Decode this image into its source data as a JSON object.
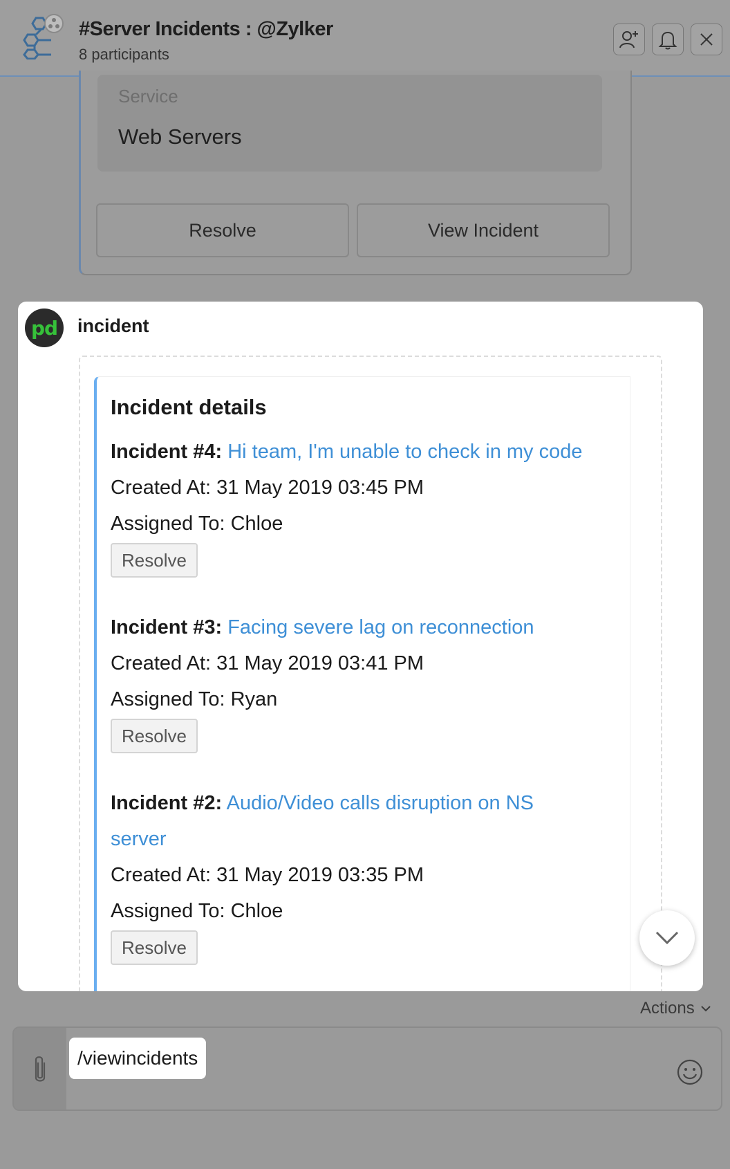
{
  "header": {
    "title": "#Server Incidents : @Zylker",
    "participants": "8 participants"
  },
  "previous_card": {
    "service_label": "Service",
    "service_value": "Web Servers",
    "buttons": [
      "Resolve",
      "View Incident"
    ]
  },
  "message": {
    "sender": "incident",
    "avatar_text": "pd",
    "card_title": "Incident details",
    "incidents": [
      {
        "label": "Incident #4:",
        "title": "Hi team, I'm unable to check in my code",
        "created_label": "Created At:",
        "created_value": "31 May 2019 03:45 PM",
        "assigned_label": "Assigned To:",
        "assigned_value": "Chloe",
        "button": "Resolve"
      },
      {
        "label": "Incident #3:",
        "title": "Facing severe lag on reconnection",
        "created_label": "Created At:",
        "created_value": "31 May 2019 03:41 PM",
        "assigned_label": "Assigned To:",
        "assigned_value": "Ryan",
        "button": "Resolve"
      },
      {
        "label": "Incident #2:",
        "title": "Audio/Video calls disruption on NS server",
        "created_label": "Created At:",
        "created_value": "31 May 2019 03:35 PM",
        "assigned_label": "Assigned To:",
        "assigned_value": "Chloe",
        "button": "Resolve"
      }
    ]
  },
  "composer": {
    "actions_label": "Actions",
    "input_value": "/viewincidents"
  },
  "colors": {
    "link": "#3e8fd6",
    "card_accent": "#6aaef0",
    "avatar_green": "#36c13a"
  }
}
